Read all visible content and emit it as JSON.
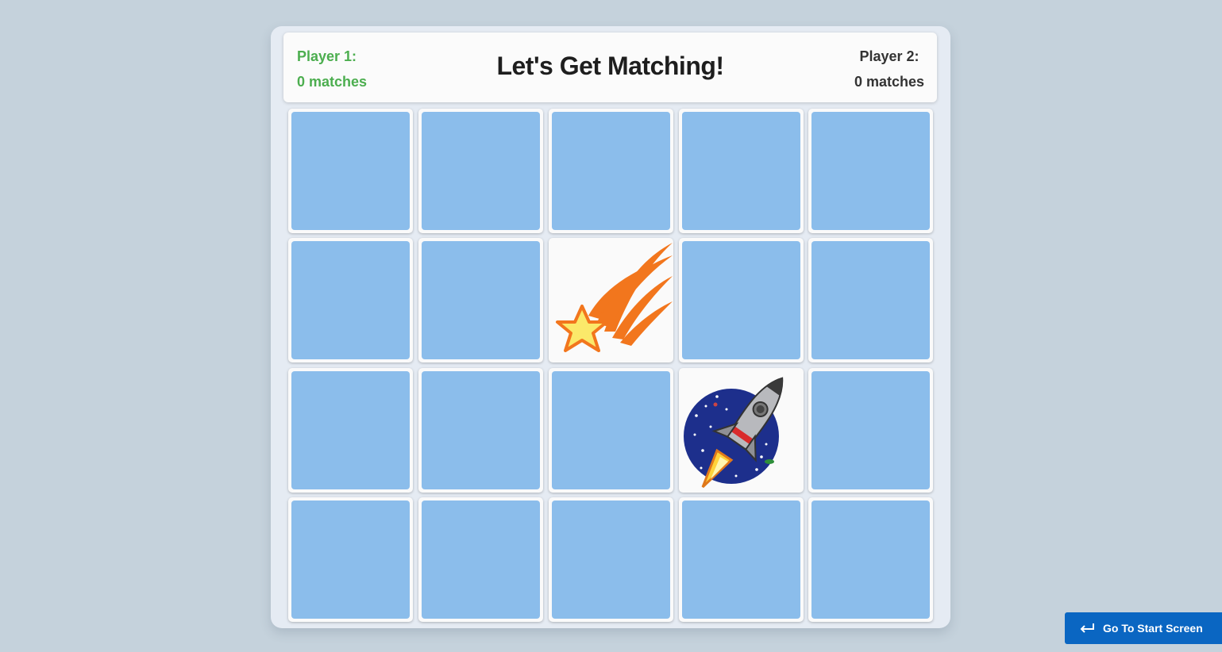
{
  "header": {
    "title": "Let's Get Matching!",
    "player1": {
      "label": "Player 1:",
      "score": "0 matches"
    },
    "player2": {
      "label": "Player 2:",
      "score": "0 matches"
    }
  },
  "grid": {
    "rows": 4,
    "columns": 5,
    "revealed_cards": [
      {
        "row": 2,
        "column": 3,
        "image": "shooting-star"
      },
      {
        "row": 3,
        "column": 4,
        "image": "rocket"
      }
    ]
  },
  "footer": {
    "start_button_label": "Go To Start Screen",
    "start_button_icon": "return-arrow-icon"
  },
  "colors": {
    "card_back": "#8bbdeb",
    "player1": "#4cae4f",
    "button": "#0a66c2",
    "background": "#c5d2dc"
  }
}
